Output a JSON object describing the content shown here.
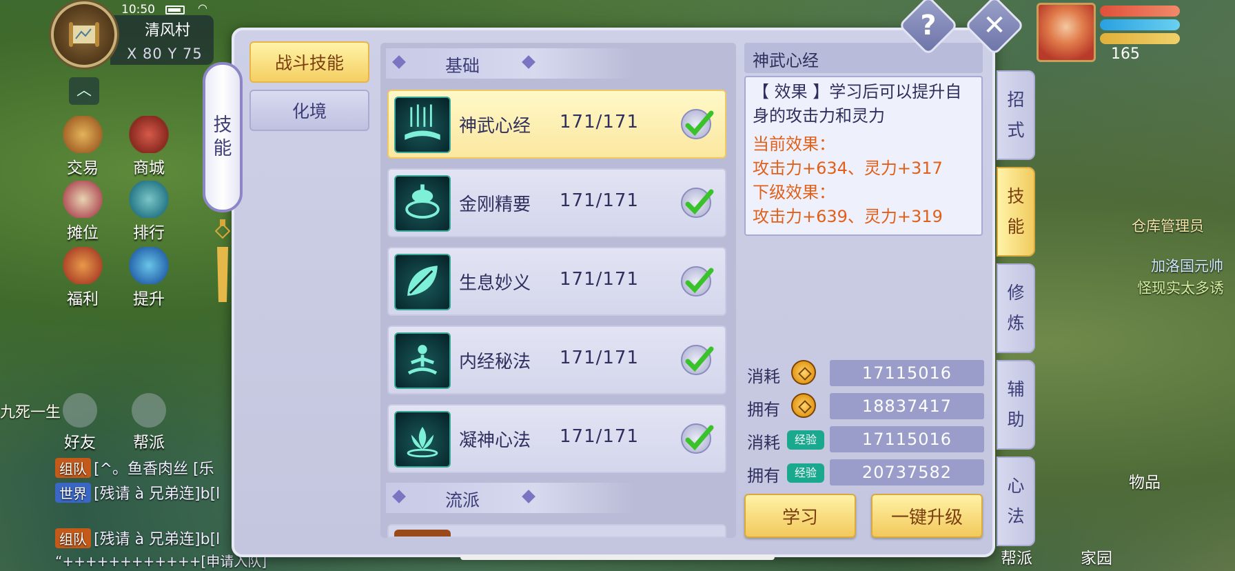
{
  "status": {
    "time": "10:50"
  },
  "location": {
    "name": "清风村",
    "coords": "X 80  Y 75"
  },
  "hud_left": [
    {
      "label": "交易",
      "icon": "trade-icon"
    },
    {
      "label": "商城",
      "icon": "shop-icon"
    },
    {
      "label": "摊位",
      "icon": "stall-icon"
    },
    {
      "label": "排行",
      "icon": "ranking-icon"
    },
    {
      "label": "福利",
      "icon": "welfare-icon"
    },
    {
      "label": "提升",
      "icon": "upgrade-icon"
    },
    {
      "label": "好友",
      "icon": "friends-icon"
    },
    {
      "label": "帮派",
      "icon": "guild-voice-icon"
    }
  ],
  "chat": [
    {
      "tag": "组队",
      "text": "[^。鱼香肉丝 [乐"
    },
    {
      "tag": "世界",
      "text": "[残请 à 兄弟连]b[l"
    },
    {
      "tag": "组队",
      "text": "[残请 à 兄弟连]b[l"
    }
  ],
  "chat_fragments": {
    "a": "九死一生",
    "b": "“++++++++++++[申请入队]"
  },
  "player": {
    "level": "165"
  },
  "world_labels": {
    "npc1": "仓库管理员",
    "npc2": "加洛国元帅",
    "npc3": "怪现实太多诱",
    "items": "物品",
    "home": "家园",
    "guild": "帮派"
  },
  "dialog": {
    "side_tab": [
      "技",
      "能"
    ],
    "categories": [
      {
        "label": "战斗技能",
        "active": true
      },
      {
        "label": "化境",
        "active": false
      }
    ],
    "section_basic": "基础",
    "section_school": "流派",
    "skills": [
      {
        "name": "神武心经",
        "level": "171/171",
        "selected": true,
        "icon": "meditation-scroll-icon"
      },
      {
        "name": "金刚精要",
        "level": "171/171",
        "selected": false,
        "icon": "vajra-bell-icon"
      },
      {
        "name": "生息妙义",
        "level": "171/171",
        "selected": false,
        "icon": "leaf-icon"
      },
      {
        "name": "内经秘法",
        "level": "171/171",
        "selected": false,
        "icon": "meditating-figure-icon"
      },
      {
        "name": "凝神心法",
        "level": "171/171",
        "selected": false,
        "icon": "lotus-icon"
      }
    ],
    "detail": {
      "title": "神武心经",
      "effect": "【 效果 】学习后可以提升自身的攻击力和灵力",
      "current_label": "当前效果：",
      "current_value": "攻击力+634、灵力+317",
      "next_label": "下级效果：",
      "next_value": "攻击力+639、灵力+319"
    },
    "costs": [
      {
        "label": "消耗",
        "kind": "coin",
        "value": "17115016"
      },
      {
        "label": "拥有",
        "kind": "coin",
        "value": "18837417"
      },
      {
        "label": "消耗",
        "kind": "exp",
        "badge": "经验",
        "value": "17115016"
      },
      {
        "label": "拥有",
        "kind": "exp",
        "badge": "经验",
        "value": "20737582"
      }
    ],
    "buttons": {
      "learn": "学习",
      "upgrade_all": "一键升级",
      "help": "?",
      "close": "✕"
    },
    "vtabs": [
      {
        "chars": [
          "招",
          "式"
        ],
        "active": false
      },
      {
        "chars": [
          "技",
          "能"
        ],
        "active": true
      },
      {
        "chars": [
          "修",
          "炼"
        ],
        "active": false
      },
      {
        "chars": [
          "辅",
          "助"
        ],
        "active": false
      },
      {
        "chars": [
          "心",
          "法"
        ],
        "active": false
      }
    ]
  },
  "colors": {
    "accent_gold": "#f4cf62",
    "effect_orange": "#e0601a",
    "exp_green": "#1aa88e",
    "panel_lavender": "#c4c6df"
  }
}
